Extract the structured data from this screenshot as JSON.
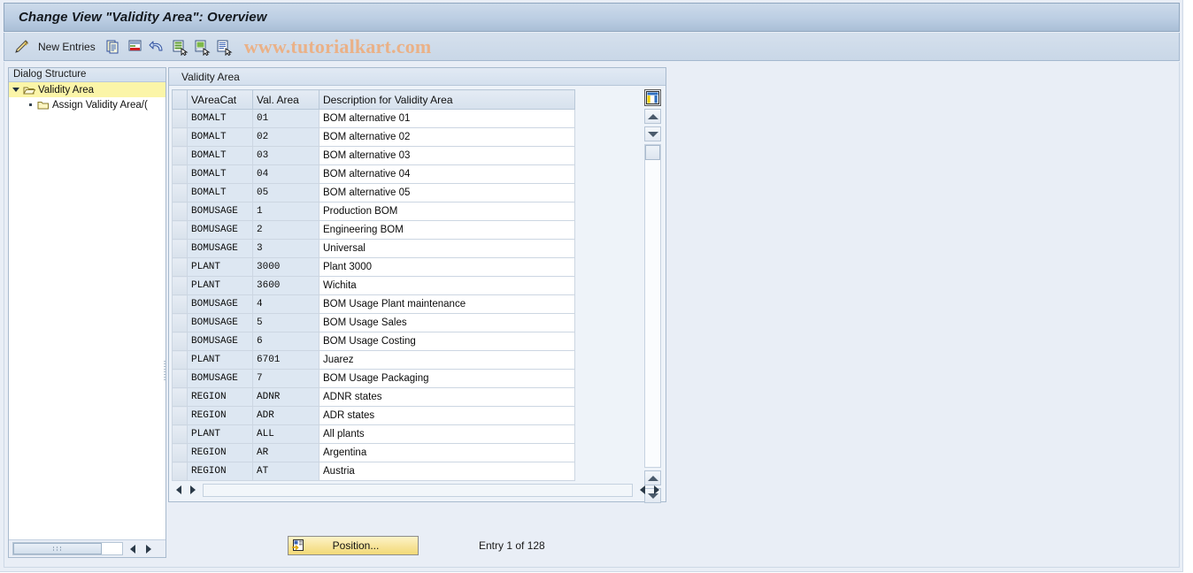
{
  "window": {
    "title": "Change View \"Validity Area\": Overview"
  },
  "toolbar": {
    "new_entries_label": "New Entries",
    "watermark": "www.tutorialkart.com",
    "icons": [
      {
        "name": "pencil-overview-icon",
        "label": "Overview / Display-Change"
      },
      {
        "name": "copy-icon",
        "label": "Copy As..."
      },
      {
        "name": "delete-icon",
        "label": "Delete"
      },
      {
        "name": "undo-icon",
        "label": "Undo Change"
      },
      {
        "name": "select-all-icon",
        "label": "Select All"
      },
      {
        "name": "deselect-all-icon",
        "label": "Deselect All"
      },
      {
        "name": "select-block-icon",
        "label": "Select Block"
      }
    ]
  },
  "sidebar": {
    "header": "Dialog Structure",
    "items": [
      {
        "label": "Validity Area",
        "icon": "open-folder-icon",
        "selected": true,
        "level": 0
      },
      {
        "label": "Assign Validity Area/(",
        "icon": "closed-folder-icon",
        "selected": false,
        "level": 1
      }
    ]
  },
  "table": {
    "caption": "Validity Area",
    "columns": [
      "VAreaCat",
      "Val. Area",
      "Description for Validity Area"
    ],
    "rows": [
      [
        "BOMALT",
        "01",
        "BOM alternative 01"
      ],
      [
        "BOMALT",
        "02",
        "BOM alternative 02"
      ],
      [
        "BOMALT",
        "03",
        "BOM alternative 03"
      ],
      [
        "BOMALT",
        "04",
        "BOM alternative 04"
      ],
      [
        "BOMALT",
        "05",
        "BOM alternative 05"
      ],
      [
        "BOMUSAGE",
        "1",
        "Production BOM"
      ],
      [
        "BOMUSAGE",
        "2",
        "Engineering BOM"
      ],
      [
        "BOMUSAGE",
        "3",
        "Universal"
      ],
      [
        "PLANT",
        "3000",
        "Plant 3000"
      ],
      [
        "PLANT",
        "3600",
        "Wichita"
      ],
      [
        "BOMUSAGE",
        "4",
        "BOM Usage Plant maintenance"
      ],
      [
        "BOMUSAGE",
        "5",
        "BOM Usage Sales"
      ],
      [
        "BOMUSAGE",
        "6",
        "BOM Usage Costing"
      ],
      [
        "PLANT",
        "6701",
        "Juarez"
      ],
      [
        "BOMUSAGE",
        "7",
        "BOM Usage Packaging"
      ],
      [
        "REGION",
        "ADNR",
        "ADNR states"
      ],
      [
        "REGION",
        "ADR",
        "ADR states"
      ],
      [
        "PLANT",
        "ALL",
        "All plants"
      ],
      [
        "REGION",
        "AR",
        "Argentina"
      ],
      [
        "REGION",
        "AT",
        "Austria"
      ]
    ]
  },
  "footer": {
    "position_label": "Position...",
    "entry_count": "Entry 1 of 128"
  },
  "colors": {
    "title_bar": "#bccee3",
    "selection_highlight": "#fbf5a8",
    "watermark": "#eab187",
    "button_yellow": "#f7e49a",
    "body_background": "#e9eef6"
  }
}
